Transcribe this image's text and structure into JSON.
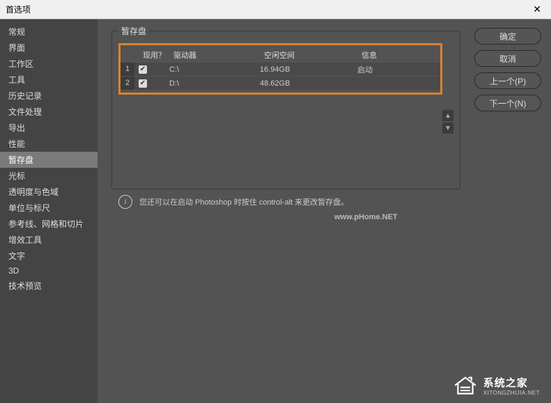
{
  "window": {
    "title": "首选项"
  },
  "sidebar": {
    "items": [
      "常规",
      "界面",
      "工作区",
      "工具",
      "历史记录",
      "文件处理",
      "导出",
      "性能",
      "暂存盘",
      "光标",
      "透明度与色域",
      "单位与标尺",
      "参考线、网格和切片",
      "增效工具",
      "文字",
      "3D",
      "技术预览"
    ],
    "selected_index": 8
  },
  "panel": {
    "title": "暂存盘",
    "columns": {
      "use": "现用？",
      "drive": "驱动器",
      "free": "空闲空间",
      "info": "信息"
    },
    "rows": [
      {
        "idx": "1",
        "checked": true,
        "drive": "C:\\",
        "free": "16.94GB",
        "info": "启动"
      },
      {
        "idx": "2",
        "checked": true,
        "drive": "D:\\",
        "free": "48.62GB",
        "info": ""
      }
    ],
    "hint": "您还可以在启动 Photoshop 时按住 control-alt 来更改暂存盘。"
  },
  "buttons": {
    "ok": "确定",
    "cancel": "取消",
    "prev": "上一个(P)",
    "next": "下一个(N)"
  },
  "watermark": {
    "text": "www.pHome.NET",
    "brand": "系统之家",
    "url": "XITONGZHIJIA.NET"
  }
}
